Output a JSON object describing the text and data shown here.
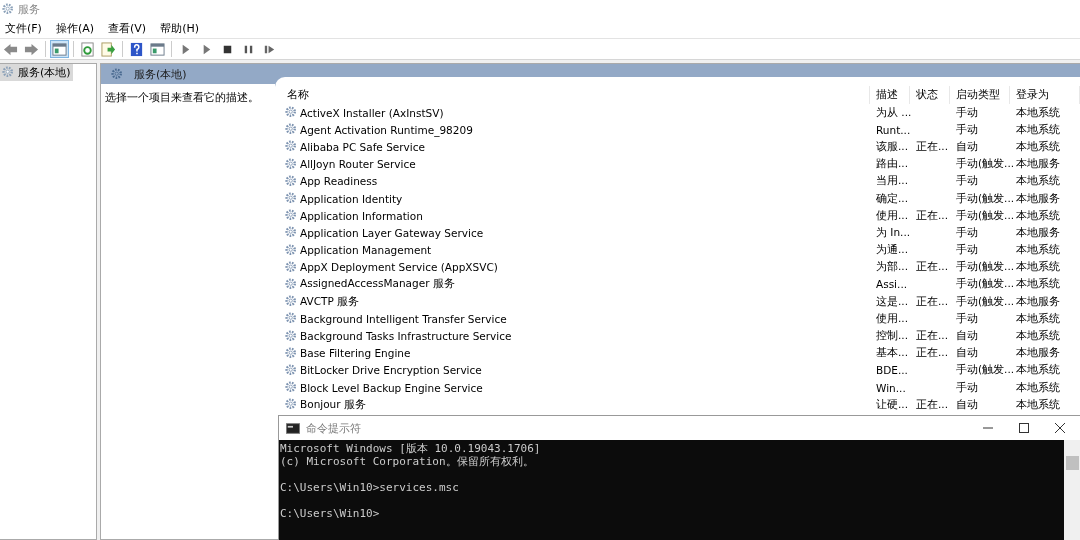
{
  "window": {
    "title": "服务"
  },
  "menu": [
    "文件(F)",
    "操作(A)",
    "查看(V)",
    "帮助(H)"
  ],
  "toolbar": [
    {
      "kind": "back",
      "pressed": false
    },
    {
      "kind": "forward",
      "pressed": false
    },
    {
      "kind": "sep"
    },
    {
      "kind": "tree",
      "pressed": true
    },
    {
      "kind": "sep"
    },
    {
      "kind": "refresh",
      "pressed": false
    },
    {
      "kind": "export",
      "pressed": false
    },
    {
      "kind": "sep"
    },
    {
      "kind": "help",
      "pressed": false
    },
    {
      "kind": "view",
      "pressed": false
    },
    {
      "kind": "sep"
    },
    {
      "kind": "play",
      "pressed": false
    },
    {
      "kind": "play",
      "pressed": false
    },
    {
      "kind": "stop",
      "pressed": false
    },
    {
      "kind": "pause",
      "pressed": false
    },
    {
      "kind": "resume",
      "pressed": false
    }
  ],
  "tree": {
    "items": [
      {
        "label": "服务(本地)",
        "selected": true
      }
    ]
  },
  "pane": {
    "title": "服务(本地)",
    "description": "选择一个项目来查看它的描述。"
  },
  "table": {
    "columns": [
      "名称",
      "描述",
      "状态",
      "启动类型",
      "登录为"
    ],
    "rows": [
      {
        "name": "ActiveX Installer (AxInstSV)",
        "description": "为从 ...",
        "status": "",
        "startup": "手动",
        "logon": "本地系统"
      },
      {
        "name": "Agent Activation Runtime_98209",
        "description": "Runt...",
        "status": "",
        "startup": "手动",
        "logon": "本地系统"
      },
      {
        "name": "Alibaba PC Safe Service",
        "description": "该服...",
        "status": "正在...",
        "startup": "自动",
        "logon": "本地系统"
      },
      {
        "name": "AllJoyn Router Service",
        "description": "路由...",
        "status": "",
        "startup": "手动(触发...",
        "logon": "本地服务"
      },
      {
        "name": "App Readiness",
        "description": "当用...",
        "status": "",
        "startup": "手动",
        "logon": "本地系统"
      },
      {
        "name": "Application Identity",
        "description": "确定...",
        "status": "",
        "startup": "手动(触发...",
        "logon": "本地服务"
      },
      {
        "name": "Application Information",
        "description": "使用...",
        "status": "正在...",
        "startup": "手动(触发...",
        "logon": "本地系统"
      },
      {
        "name": "Application Layer Gateway Service",
        "description": "为 In...",
        "status": "",
        "startup": "手动",
        "logon": "本地服务"
      },
      {
        "name": "Application Management",
        "description": "为通...",
        "status": "",
        "startup": "手动",
        "logon": "本地系统"
      },
      {
        "name": "AppX Deployment Service (AppXSVC)",
        "description": "为部...",
        "status": "正在...",
        "startup": "手动(触发...",
        "logon": "本地系统"
      },
      {
        "name": "AssignedAccessManager 服务",
        "description": "Assi...",
        "status": "",
        "startup": "手动(触发...",
        "logon": "本地系统"
      },
      {
        "name": "AVCTP 服务",
        "description": "这是...",
        "status": "正在...",
        "startup": "手动(触发...",
        "logon": "本地服务"
      },
      {
        "name": "Background Intelligent Transfer Service",
        "description": "使用...",
        "status": "",
        "startup": "手动",
        "logon": "本地系统"
      },
      {
        "name": "Background Tasks Infrastructure Service",
        "description": "控制...",
        "status": "正在...",
        "startup": "自动",
        "logon": "本地系统"
      },
      {
        "name": "Base Filtering Engine",
        "description": "基本...",
        "status": "正在...",
        "startup": "自动",
        "logon": "本地服务"
      },
      {
        "name": "BitLocker Drive Encryption Service",
        "description": "BDE...",
        "status": "",
        "startup": "手动(触发...",
        "logon": "本地系统"
      },
      {
        "name": "Block Level Backup Engine Service",
        "description": "Win...",
        "status": "",
        "startup": "手动",
        "logon": "本地系统"
      },
      {
        "name": "Bonjour 服务",
        "description": "让硬...",
        "status": "正在...",
        "startup": "自动",
        "logon": "本地系统"
      }
    ]
  },
  "console": {
    "title": "命令提示符",
    "blocks": [
      [
        "Microsoft Windows [版本 10.0.19043.1706]",
        "(c) Microsoft Corporation。保留所有权利。"
      ],
      [
        "C:\\Users\\Win10>services.msc"
      ],
      [
        "C:\\Users\\Win10>"
      ]
    ]
  }
}
